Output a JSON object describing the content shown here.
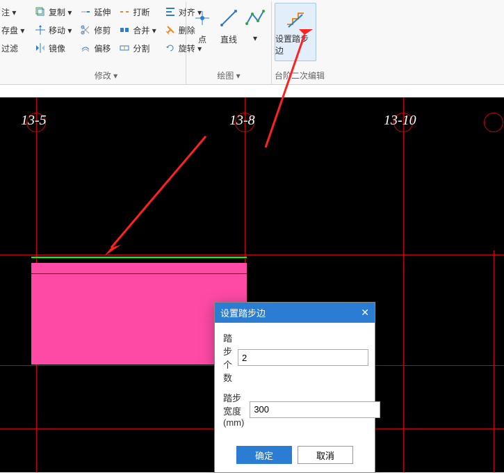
{
  "ribbon": {
    "left": {
      "item1": "注 ▾",
      "item2": "存盘 ▾",
      "item3": "过滤"
    },
    "modify": {
      "copy": "复制 ▾",
      "move": "移动 ▾",
      "mirror": "镜像",
      "extend": "延伸",
      "trim": "修剪",
      "offset": "偏移",
      "break": "打断",
      "merge": "合并 ▾",
      "split": "分割",
      "align": "对齐 ▾",
      "delete": "删除",
      "rotate": "旋转 ▾",
      "group_label": "修改 ▾"
    },
    "draw": {
      "point": "点",
      "line": "直线",
      "more": "▾",
      "group_label": "绘图 ▾"
    },
    "setstep": {
      "label": "设置踏步边",
      "group_label": "台阶二次编辑"
    }
  },
  "grid": {
    "g1": "13-5",
    "g2": "13-8",
    "g3": "13-10"
  },
  "dialog": {
    "title": "设置踏步边",
    "row1_label": "踏步个数",
    "row1_value": "2",
    "row2_label": "踏步宽度(mm)",
    "row2_value": "300",
    "ok": "确定",
    "cancel": "取消"
  }
}
